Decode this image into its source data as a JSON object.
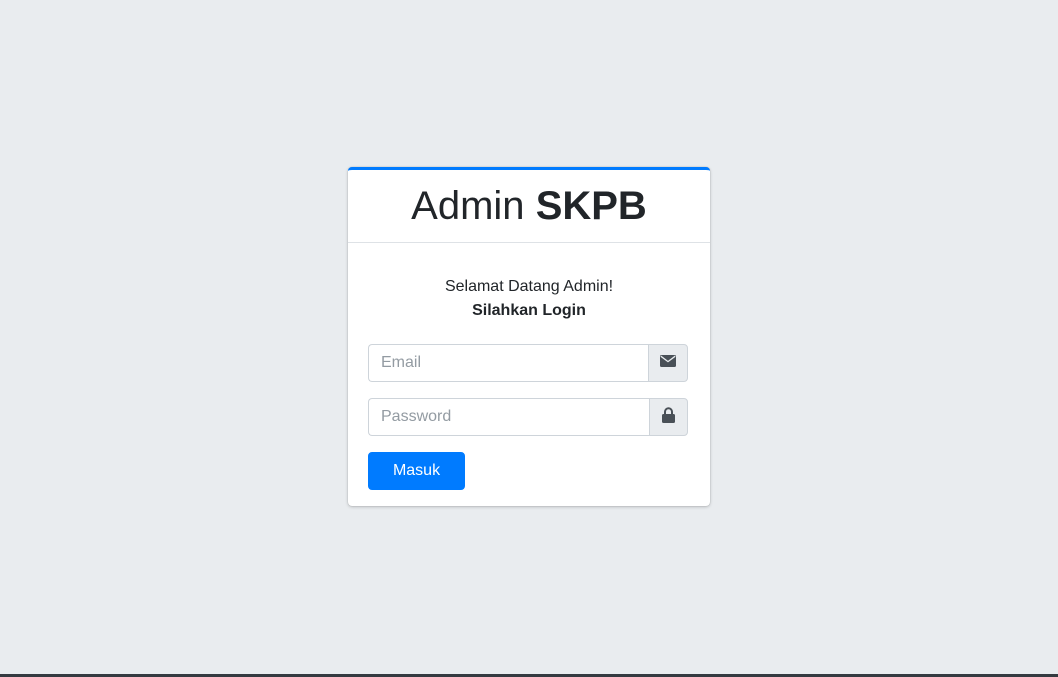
{
  "login": {
    "title_prefix": "Admin",
    "title_brand": "SKPB",
    "welcome_line": "Selamat Datang Admin!",
    "instruction_line": "Silahkan Login",
    "email": {
      "placeholder": "Email",
      "value": "",
      "icon": "envelope-icon"
    },
    "password": {
      "placeholder": "Password",
      "value": "",
      "icon": "lock-icon"
    },
    "submit_label": "Masuk"
  },
  "colors": {
    "accent": "#007bff",
    "background": "#e9ecef",
    "card": "#ffffff",
    "text": "#212529"
  }
}
